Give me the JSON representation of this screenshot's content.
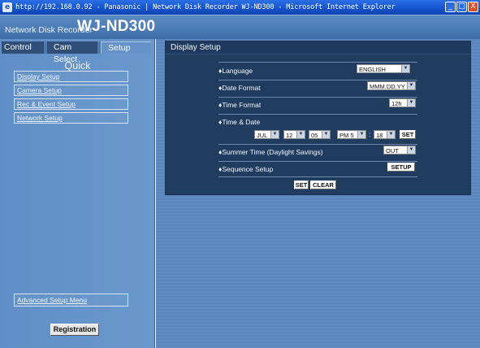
{
  "window": {
    "title": "http://192.168.0.92 - Panasonic | Network Disk Recorder WJ-ND300 - Microsoft Internet Explorer",
    "ie_icon": "e",
    "min": "_",
    "max": "□",
    "close": "X"
  },
  "header": {
    "subtitle": "Network Disk Recorder",
    "model": "WJ-ND300"
  },
  "tabs": {
    "control": "Control",
    "cam_select": "Cam Select",
    "setup": "Setup"
  },
  "sidebar": {
    "heading": "Quick",
    "items": [
      "Display Setup",
      "Camera Setup",
      "Rec & Event Setup",
      "Network Setup"
    ],
    "advanced": "Advanced Setup Menu",
    "registration": "Registration"
  },
  "panel": {
    "title": "Display Setup",
    "language": {
      "label": "♦Language",
      "value": "ENGLISH"
    },
    "date_format": {
      "label": "♦Date Format",
      "value": "MMM.DD.YY"
    },
    "time_format": {
      "label": "♦Time Format",
      "value": "12h"
    },
    "time_date": {
      "label": "♦Time & Date",
      "month": "JUL",
      "day": "12",
      "year": "05",
      "hour": "PM 5",
      "colon": ":",
      "minute": "18",
      "set": "SET"
    },
    "summer_time": {
      "label": "♦Summer Time (Daylight Savings)",
      "value": "OUT"
    },
    "sequence": {
      "label": "♦Sequence Setup",
      "button": "SETUP"
    },
    "set_button": "SET",
    "clear_button": "CLEAR"
  },
  "icons": {
    "dropdown_arrow": "▼"
  },
  "colors": {
    "titlebar": "#1652c9",
    "panel_bg": "#203d60",
    "sidebar_bg": "#6592c8"
  }
}
